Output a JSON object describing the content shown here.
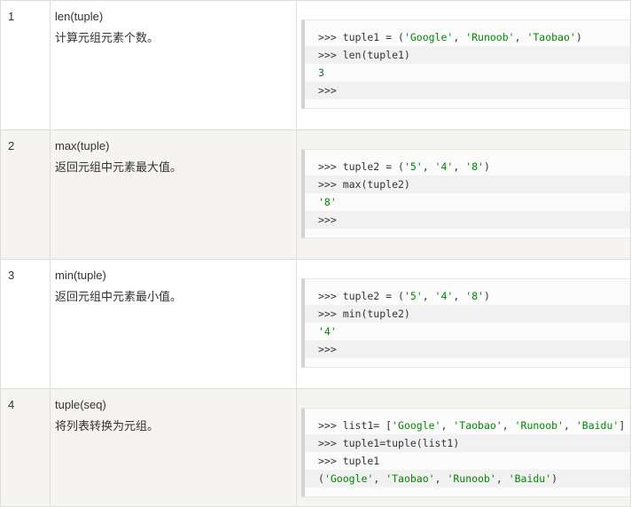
{
  "rows": [
    {
      "num": "1",
      "func": "len(tuple)",
      "desc": "计算元组元素个数。",
      "code": [
        ">>> tuple1 = ('Google', 'Runoob', 'Taobao')",
        ">>> len(tuple1)",
        "3",
        ">>>"
      ]
    },
    {
      "num": "2",
      "func": "max(tuple)",
      "desc": "返回元组中元素最大值。",
      "code": [
        ">>> tuple2 = ('5', '4', '8')",
        ">>> max(tuple2)",
        "'8'",
        ">>>"
      ]
    },
    {
      "num": "3",
      "func": "min(tuple)",
      "desc": "返回元组中元素最小值。",
      "code": [
        ">>> tuple2 = ('5', '4', '8')",
        ">>> min(tuple2)",
        "'4'",
        ">>>"
      ]
    },
    {
      "num": "4",
      "func": "tuple(seq)",
      "desc": "将列表转换为元组。",
      "code": [
        ">>> list1= ['Google', 'Taobao', 'Runoob', 'Baidu']",
        ">>> tuple1=tuple(list1)",
        ">>> tuple1",
        "('Google', 'Taobao', 'Runoob', 'Baidu')"
      ]
    }
  ]
}
